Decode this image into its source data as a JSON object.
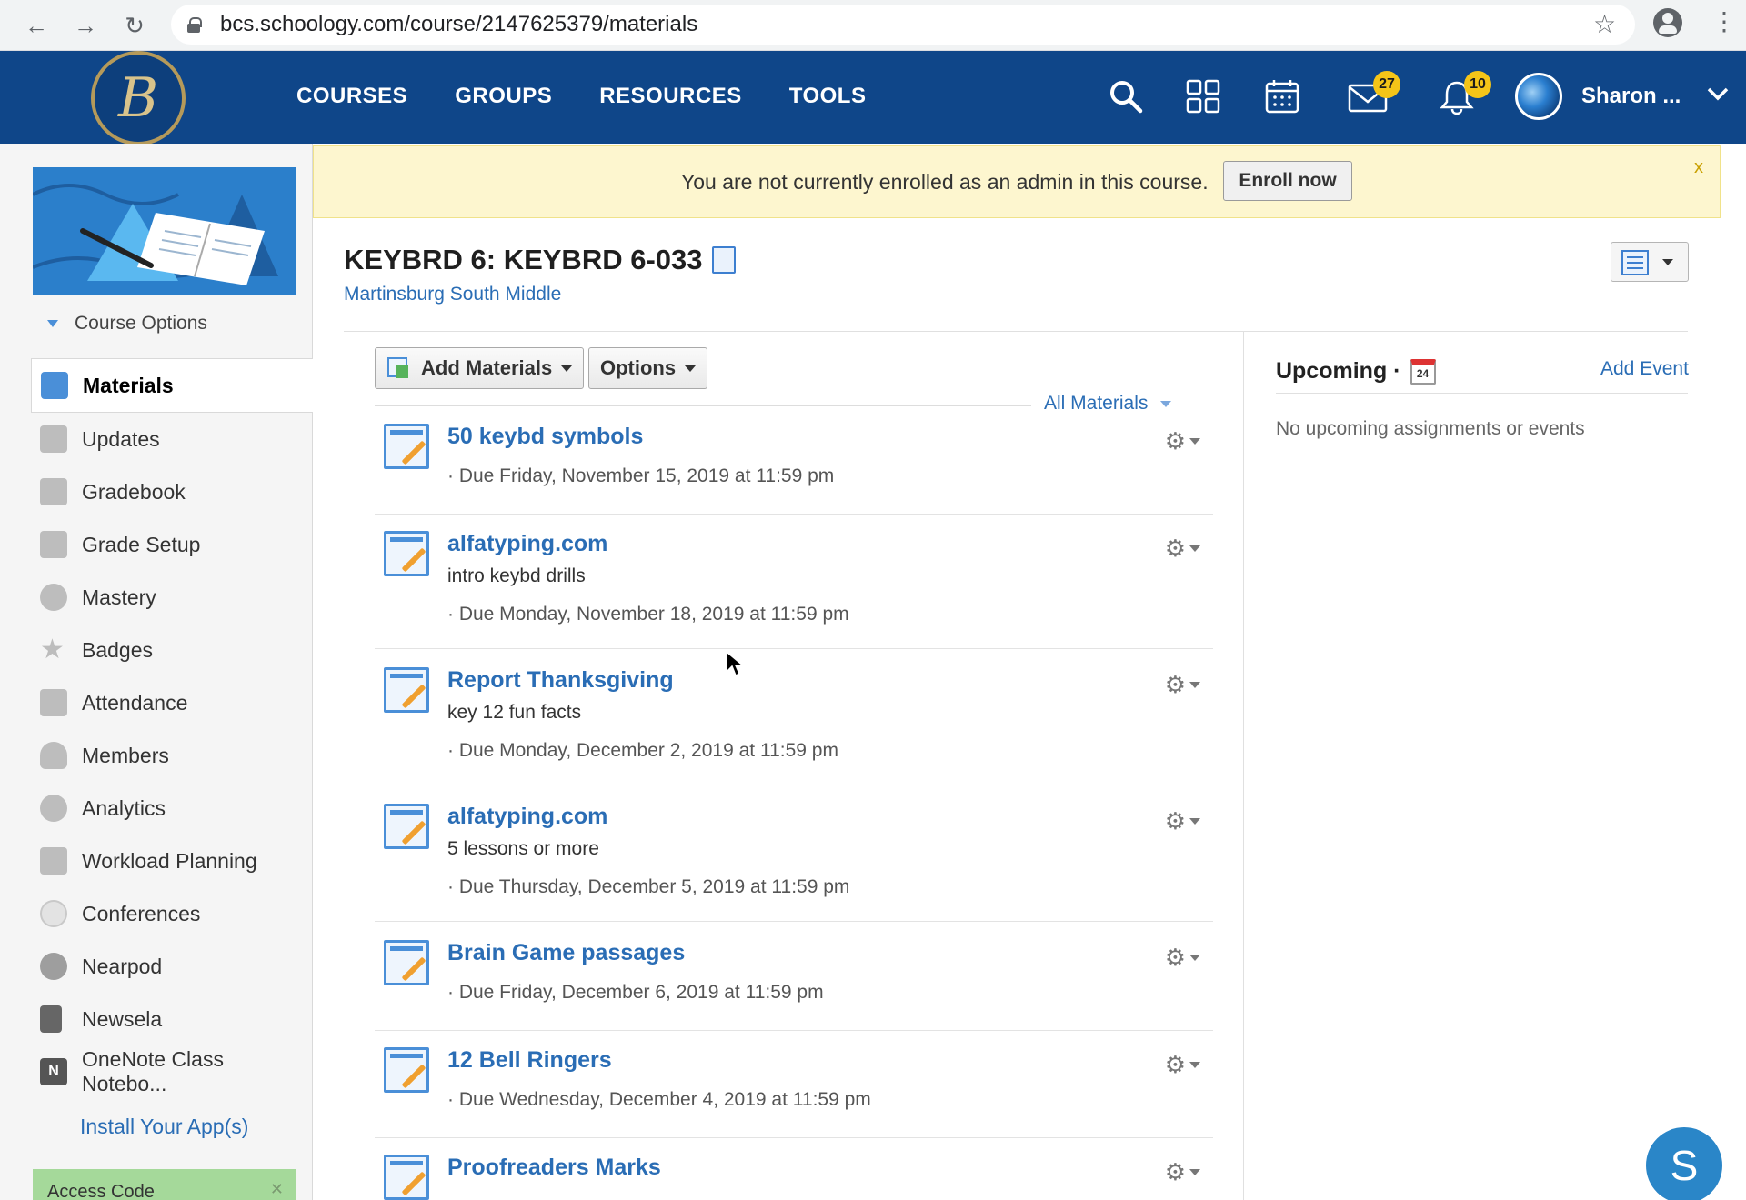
{
  "browser": {
    "url": "bcs.schoology.com/course/2147625379/materials"
  },
  "topnav": {
    "links": [
      "COURSES",
      "GROUPS",
      "RESOURCES",
      "TOOLS"
    ],
    "messages_badge": "27",
    "notifications_badge": "10",
    "user_name": "Sharon ..."
  },
  "banner": {
    "text": "You are not currently enrolled as an admin in this course.",
    "button": "Enroll now",
    "close": "x"
  },
  "course": {
    "title": "KEYBRD 6: KEYBRD 6-033",
    "school": "Martinsburg South Middle"
  },
  "sidebar": {
    "course_options": "Course Options",
    "items": [
      {
        "label": "Materials",
        "icon": "materials-icon"
      },
      {
        "label": "Updates",
        "icon": "updates-icon"
      },
      {
        "label": "Gradebook",
        "icon": "gradebook-icon"
      },
      {
        "label": "Grade Setup",
        "icon": "grade-setup-icon"
      },
      {
        "label": "Mastery",
        "icon": "mastery-icon"
      },
      {
        "label": "Badges",
        "icon": "badges-icon"
      },
      {
        "label": "Attendance",
        "icon": "attendance-icon"
      },
      {
        "label": "Members",
        "icon": "members-icon"
      },
      {
        "label": "Analytics",
        "icon": "analytics-icon"
      },
      {
        "label": "Workload Planning",
        "icon": "workload-icon"
      },
      {
        "label": "Conferences",
        "icon": "conferences-icon"
      },
      {
        "label": "Nearpod",
        "icon": "nearpod-icon"
      },
      {
        "label": "Newsela",
        "icon": "newsela-icon"
      },
      {
        "label": "OneNote Class Notebo...",
        "icon": "onenote-icon"
      }
    ],
    "install_link": "Install Your App(s)",
    "access_code": "Access Code"
  },
  "toolbar": {
    "add_materials": "Add Materials",
    "options": "Options",
    "filter": "All Materials"
  },
  "materials": [
    {
      "title": "50 keybd symbols",
      "desc": "",
      "due": "· Due Friday, November 15, 2019 at 11:59 pm"
    },
    {
      "title": "alfatyping.com",
      "desc": "intro keybd drills",
      "due": "· Due Monday, November 18, 2019 at 11:59 pm"
    },
    {
      "title": "Report Thanksgiving",
      "desc": "key 12 fun facts",
      "due": "· Due Monday, December 2, 2019 at 11:59 pm"
    },
    {
      "title": "alfatyping.com",
      "desc": "5 lessons or more",
      "due": "· Due Thursday, December 5, 2019 at 11:59 pm"
    },
    {
      "title": "Brain Game passages",
      "desc": "",
      "due": "· Due Friday, December 6, 2019 at 11:59 pm"
    },
    {
      "title": "12 Bell Ringers",
      "desc": "",
      "due": "· Due Wednesday, December 4, 2019 at 11:59 pm"
    },
    {
      "title": "Proofreaders Marks",
      "desc": "",
      "due": ""
    }
  ],
  "upcoming": {
    "title": "Upcoming ·",
    "calendar_day": "24",
    "add_event": "Add Event",
    "empty": "No upcoming assignments or events"
  },
  "chat": {
    "letter": "S"
  }
}
